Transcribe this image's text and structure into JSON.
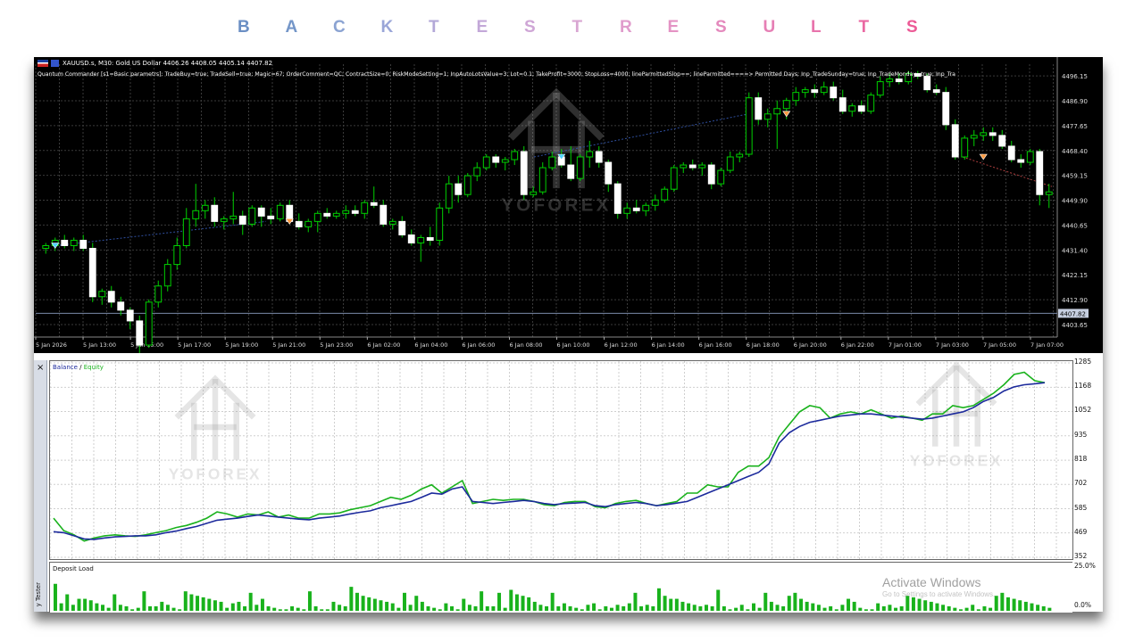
{
  "banner": {
    "title_letters": [
      "B",
      "A",
      "C",
      "K",
      "T",
      "E",
      "S",
      "T",
      "R",
      "E",
      "S",
      "U",
      "L",
      "T",
      "S"
    ],
    "title_colors": [
      "#6b8fc4",
      "#7496c8",
      "#8ba3d2",
      "#9aa6d8",
      "#b3a8d8",
      "#c3a8d8",
      "#cfa6d6",
      "#d9a6d2",
      "#e09ccc",
      "#e493c4",
      "#e489bd",
      "#e67fb5",
      "#e874ac",
      "#ea68a2",
      "#ec5a96"
    ]
  },
  "price_chart": {
    "symbol_line": "XAUUSD.s, M30:  Gold US Dollar  4406.26 4408.05 4405.14 4407.82",
    "params_line": "Quantum Commander [s1=Basic parametrs]: TradeBuy=true; TradeSell=true; Magic=67; OrderComment=QC; ContractSize=0; RiskModeSetting=1; InpAutoLotsValue=3; Lot=0.1; TakeProfit=3000; StopLoss=4000; lineParmittedSlop==; lineParmitted====> Permitted Days; Inp_TradeSunday=true; Inp_TradeMonday=true; Inp_Tra",
    "y_ticks": [
      "4496.15",
      "4486.90",
      "4477.65",
      "4468.40",
      "4459.15",
      "4449.90",
      "4440.65",
      "4431.40",
      "4422.15",
      "4412.90",
      "4403.65"
    ],
    "current_price": "4407.82",
    "x_ticks": [
      "5 Jan 2026",
      "5 Jan 13:00",
      "5 Jan 15:00",
      "5 Jan 17:00",
      "5 Jan 19:00",
      "5 Jan 21:00",
      "5 Jan 23:00",
      "6 Jan 02:00",
      "6 Jan 04:00",
      "6 Jan 06:00",
      "6 Jan 08:00",
      "6 Jan 10:00",
      "6 Jan 12:00",
      "6 Jan 14:00",
      "6 Jan 16:00",
      "6 Jan 18:00",
      "6 Jan 20:00",
      "6 Jan 22:00",
      "7 Jan 01:00",
      "7 Jan 03:00",
      "7 Jan 05:00",
      "7 Jan 07:00"
    ],
    "candles": [
      [
        4432,
        4434,
        4430,
        4433
      ],
      [
        4433,
        4436,
        4431,
        4435
      ],
      [
        4435,
        4437,
        4432,
        4433
      ],
      [
        4433,
        4436,
        4431,
        4435
      ],
      [
        4435,
        4437,
        4431,
        4432
      ],
      [
        4432,
        4434,
        4412,
        4414
      ],
      [
        4414,
        4417,
        4411,
        4416
      ],
      [
        4416,
        4418,
        4410,
        4412
      ],
      [
        4412,
        4414,
        4407,
        4409
      ],
      [
        4409,
        4410,
        4402,
        4405
      ],
      [
        4405,
        4407,
        4393,
        4396
      ],
      [
        4396,
        4413,
        4395,
        4412
      ],
      [
        4412,
        4420,
        4410,
        4418
      ],
      [
        4418,
        4428,
        4416,
        4426
      ],
      [
        4426,
        4436,
        4424,
        4433
      ],
      [
        4433,
        4447,
        4432,
        4443
      ],
      [
        4443,
        4456,
        4440,
        4446
      ],
      [
        4446,
        4450,
        4443,
        4448
      ],
      [
        4448,
        4451,
        4440,
        4442
      ],
      [
        4442,
        4444,
        4439,
        4443
      ],
      [
        4443,
        4453,
        4441,
        4444
      ],
      [
        4444,
        4446,
        4437,
        4441
      ],
      [
        4441,
        4448,
        4440,
        4447
      ],
      [
        4447,
        4448,
        4440,
        4444
      ],
      [
        4444,
        4447,
        4441,
        4443
      ],
      [
        4443,
        4449,
        4442,
        4448
      ],
      [
        4448,
        4450,
        4441,
        4442
      ],
      [
        4442,
        4445,
        4439,
        4440
      ],
      [
        4440,
        4443,
        4438,
        4442
      ],
      [
        4442,
        4446,
        4438,
        4445
      ],
      [
        4445,
        4447,
        4443,
        4444
      ],
      [
        4444,
        4446,
        4443,
        4445
      ],
      [
        4445,
        4448,
        4443,
        4446
      ],
      [
        4446,
        4448,
        4444,
        4445
      ],
      [
        4445,
        4450,
        4443,
        4449
      ],
      [
        4449,
        4455,
        4447,
        4448
      ],
      [
        4448,
        4450,
        4440,
        4441
      ],
      [
        4441,
        4443,
        4439,
        4442
      ],
      [
        4442,
        4444,
        4436,
        4437
      ],
      [
        4437,
        4439,
        4433,
        4434
      ],
      [
        4434,
        4437,
        4427,
        4436
      ],
      [
        4436,
        4440,
        4433,
        4435
      ],
      [
        4435,
        4449,
        4433,
        4447
      ],
      [
        4447,
        4459,
        4445,
        4456
      ],
      [
        4456,
        4459,
        4449,
        4452
      ],
      [
        4452,
        4460,
        4451,
        4459
      ],
      [
        4459,
        4464,
        4457,
        4462
      ],
      [
        4462,
        4467,
        4461,
        4466
      ],
      [
        4466,
        4467,
        4462,
        4464
      ],
      [
        4464,
        4466,
        4461,
        4465
      ],
      [
        4465,
        4469,
        4463,
        4468
      ],
      [
        4468,
        4470,
        4450,
        4452
      ],
      [
        4452,
        4455,
        4451,
        4453
      ],
      [
        4453,
        4464,
        4452,
        4462
      ],
      [
        4462,
        4468,
        4461,
        4466
      ],
      [
        4466,
        4469,
        4462,
        4463
      ],
      [
        4463,
        4470,
        4457,
        4458
      ],
      [
        4458,
        4467,
        4457,
        4466
      ],
      [
        4466,
        4472,
        4462,
        4468
      ],
      [
        4468,
        4470,
        4462,
        4464
      ],
      [
        4464,
        4465,
        4453,
        4456
      ],
      [
        4456,
        4457,
        4443,
        4445
      ],
      [
        4445,
        4449,
        4443,
        4447
      ],
      [
        4447,
        4450,
        4445,
        4446
      ],
      [
        4446,
        4449,
        4444,
        4448
      ],
      [
        4448,
        4452,
        4446,
        4450
      ],
      [
        4450,
        4455,
        4449,
        4454
      ],
      [
        4454,
        4463,
        4453,
        4462
      ],
      [
        4462,
        4464,
        4460,
        4463
      ],
      [
        4463,
        4465,
        4461,
        4462
      ],
      [
        4462,
        4464,
        4459,
        4463
      ],
      [
        4463,
        4464,
        4454,
        4456
      ],
      [
        4456,
        4462,
        4455,
        4461
      ],
      [
        4461,
        4468,
        4460,
        4466
      ],
      [
        4466,
        4468,
        4464,
        4467
      ],
      [
        4467,
        4490,
        4466,
        4488
      ],
      [
        4488,
        4490,
        4478,
        4480
      ],
      [
        4480,
        4484,
        4477,
        4482
      ],
      [
        4482,
        4487,
        4469,
        4484
      ],
      [
        4484,
        4488,
        4480,
        4487
      ],
      [
        4487,
        4492,
        4485,
        4490
      ],
      [
        4490,
        4492,
        4488,
        4491
      ],
      [
        4491,
        4493,
        4488,
        4490
      ],
      [
        4490,
        4494,
        4489,
        4492
      ],
      [
        4492,
        4494,
        4487,
        4488
      ],
      [
        4488,
        4491,
        4482,
        4483
      ],
      [
        4483,
        4486,
        4481,
        4485
      ],
      [
        4485,
        4487,
        4482,
        4483
      ],
      [
        4483,
        4490,
        4482,
        4489
      ],
      [
        4489,
        4496,
        4488,
        4494
      ],
      [
        4494,
        4497,
        4492,
        4495
      ],
      [
        4495,
        4497,
        4493,
        4494
      ],
      [
        4494,
        4498,
        4493,
        4497
      ],
      [
        4497,
        4498,
        4495,
        4496
      ],
      [
        4496,
        4497,
        4490,
        4491
      ],
      [
        4491,
        4493,
        4489,
        4490
      ],
      [
        4490,
        4492,
        4476,
        4478
      ],
      [
        4478,
        4480,
        4465,
        4466
      ],
      [
        4466,
        4474,
        4465,
        4473
      ],
      [
        4473,
        4476,
        4470,
        4474
      ],
      [
        4474,
        4477,
        4472,
        4475
      ],
      [
        4475,
        4477,
        4472,
        4474
      ],
      [
        4474,
        4476,
        4469,
        4470
      ],
      [
        4470,
        4472,
        4464,
        4465
      ],
      [
        4465,
        4467,
        4462,
        4464
      ],
      [
        4464,
        4469,
        4463,
        4468
      ],
      [
        4468,
        4469,
        4448,
        4452
      ],
      [
        4452,
        4456,
        4447,
        4453
      ]
    ],
    "markers": [
      {
        "index": 1,
        "price": 4433,
        "color": "#4fd3ff"
      },
      {
        "index": 26,
        "price": 4442,
        "color": "#ff9a40"
      },
      {
        "index": 55,
        "price": 4466,
        "color": "#4fd3ff"
      },
      {
        "index": 79,
        "price": 4482,
        "color": "#ff9a40"
      },
      {
        "index": 100,
        "price": 4466,
        "color": "#ff9a40"
      }
    ],
    "watermark_text": "YOFOREX"
  },
  "tester": {
    "close_glyph": "×",
    "side_label": "y Tester",
    "balance_legend": {
      "balance": "Balance",
      "sep": " / ",
      "equity": "Equity"
    },
    "balance_y_ticks": [
      "1285",
      "1168",
      "1052",
      "935",
      "818",
      "702",
      "585",
      "469",
      "352"
    ],
    "balance_series": [
      475,
      470,
      455,
      440,
      438,
      445,
      450,
      452,
      455,
      455,
      460,
      470,
      478,
      490,
      500,
      515,
      530,
      535,
      540,
      548,
      555,
      550,
      545,
      540,
      535,
      532,
      540,
      545,
      550,
      560,
      568,
      575,
      590,
      600,
      610,
      620,
      640,
      660,
      655,
      680,
      690,
      620,
      615,
      610,
      615,
      620,
      625,
      620,
      610,
      605,
      610,
      612,
      615,
      600,
      595,
      605,
      610,
      615,
      610,
      600,
      605,
      612,
      620,
      640,
      660,
      680,
      700,
      720,
      740,
      760,
      800,
      900,
      950,
      980,
      1000,
      1010,
      1020,
      1030,
      1035,
      1040,
      1040,
      1035,
      1030,
      1025,
      1020,
      1015,
      1020,
      1030,
      1040,
      1050,
      1070,
      1100,
      1120,
      1150,
      1170,
      1180,
      1185,
      1190
    ],
    "equity_series": [
      540,
      480,
      460,
      430,
      445,
      455,
      460,
      455,
      452,
      460,
      470,
      480,
      495,
      505,
      520,
      540,
      570,
      560,
      545,
      560,
      555,
      570,
      545,
      555,
      540,
      540,
      560,
      560,
      565,
      580,
      590,
      600,
      620,
      640,
      630,
      650,
      680,
      700,
      660,
      690,
      720,
      610,
      620,
      630,
      625,
      630,
      630,
      620,
      605,
      600,
      615,
      620,
      620,
      595,
      590,
      610,
      620,
      625,
      610,
      600,
      610,
      620,
      660,
      660,
      700,
      690,
      690,
      760,
      790,
      790,
      830,
      930,
      990,
      1050,
      1080,
      1070,
      1020,
      1040,
      1050,
      1040,
      1060,
      1040,
      1020,
      1030,
      1020,
      1010,
      1040,
      1040,
      1080,
      1070,
      1080,
      1110,
      1140,
      1180,
      1230,
      1240,
      1200,
      1190
    ],
    "deposit_legend": "Deposit Load",
    "deposit_y_ticks": [
      "25.0%",
      "0.0%"
    ],
    "deposit_bars": [
      18,
      5,
      11,
      4,
      8,
      8,
      7,
      5,
      4,
      2,
      11,
      4,
      3,
      1,
      2,
      13,
      3,
      3,
      6,
      4,
      2,
      1,
      13,
      11,
      10,
      9,
      8,
      7,
      6,
      2,
      5,
      6,
      3,
      12,
      4,
      8,
      3,
      2,
      1,
      1,
      3,
      2,
      1,
      13,
      3,
      1,
      1,
      6,
      4,
      3,
      16,
      12,
      10,
      9,
      8,
      7,
      6,
      5,
      2,
      12,
      4,
      10,
      6,
      3,
      2,
      1,
      5,
      3,
      1,
      8,
      4,
      3,
      13,
      3,
      3,
      12,
      2,
      14,
      11,
      10,
      9,
      6,
      4,
      3,
      12,
      3,
      5,
      3,
      2,
      1,
      4,
      5,
      1,
      3,
      2,
      4,
      3,
      5,
      12,
      3,
      4,
      3,
      15,
      10,
      8,
      8,
      6,
      5,
      4,
      3,
      4,
      3,
      14,
      3,
      1,
      2,
      4,
      1,
      5,
      2,
      12,
      6,
      4,
      3,
      10,
      12,
      8,
      6,
      5,
      4,
      2,
      3,
      1,
      4,
      8,
      6,
      2,
      1,
      1,
      5,
      3,
      4,
      2,
      3,
      10,
      9,
      8,
      7,
      6,
      5,
      4,
      3,
      2,
      1,
      2,
      4,
      1,
      3,
      2,
      10,
      12,
      9,
      8,
      7,
      6,
      5,
      4,
      3,
      2
    ],
    "activate_title": "Activate Windows",
    "activate_sub": "Go to Settings to activate Windows."
  }
}
